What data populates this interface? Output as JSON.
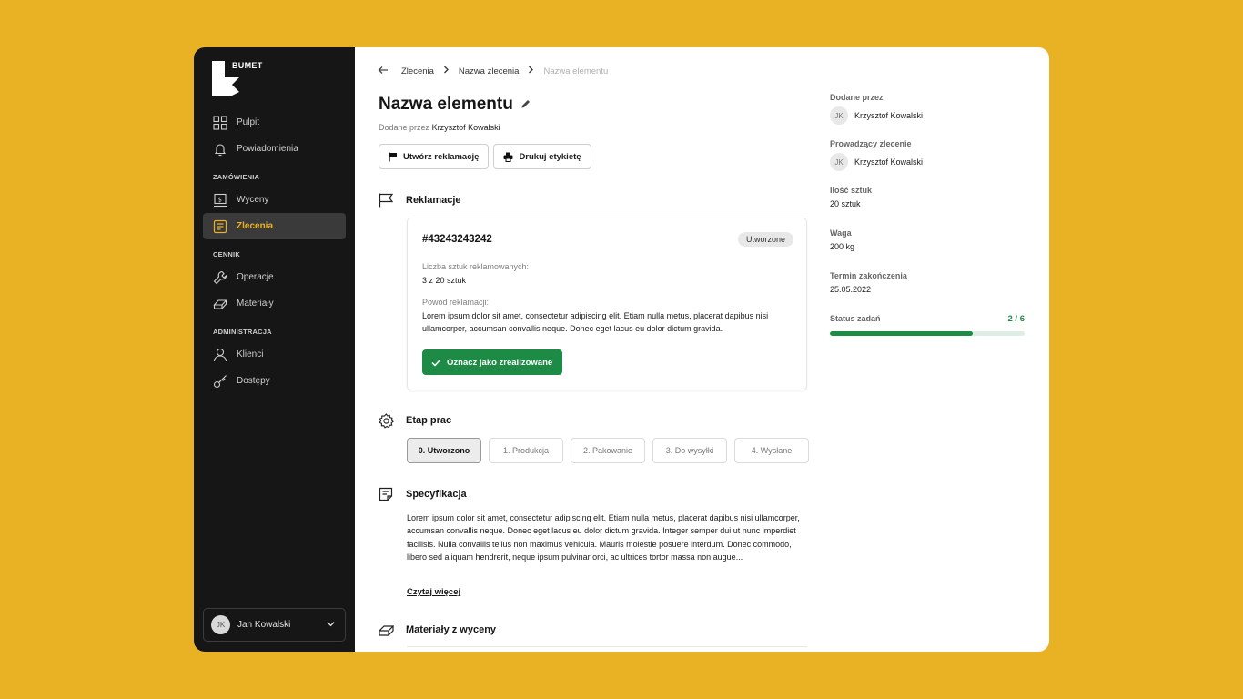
{
  "brand": {
    "name": "BUMET"
  },
  "sidebar": {
    "items_top": [
      {
        "label": "Pulpit",
        "icon": "grid-icon"
      },
      {
        "label": "Powiadomienia",
        "icon": "bell-icon"
      }
    ],
    "sections": [
      {
        "title": "ZAMÓWIENIA",
        "items": [
          {
            "label": "Wyceny",
            "icon": "quote-icon"
          },
          {
            "label": "Zlecenia",
            "icon": "orders-icon",
            "active": true
          }
        ]
      },
      {
        "title": "CENNIK",
        "items": [
          {
            "label": "Operacje",
            "icon": "wrench-icon"
          },
          {
            "label": "Materiały",
            "icon": "materials-icon"
          }
        ]
      },
      {
        "title": "ADMINISTRACJA",
        "items": [
          {
            "label": "Klienci",
            "icon": "user-icon"
          },
          {
            "label": "Dostępy",
            "icon": "key-icon"
          }
        ]
      }
    ],
    "user": {
      "initials": "JK",
      "name": "Jan Kowalski"
    }
  },
  "breadcrumb": {
    "items": [
      "Zlecenia",
      "Nazwa zlecenia",
      "Nazwa elementu"
    ]
  },
  "page": {
    "title": "Nazwa elementu",
    "added_by_prefix": "Dodane przez",
    "added_by_name": "Krzysztof Kowalski",
    "actions": {
      "complaint": "Utwórz reklamację",
      "print": "Drukuj etykietę"
    }
  },
  "complaints": {
    "title": "Reklamacje",
    "card": {
      "id": "#43243243242",
      "status": "Utworzone",
      "count_label": "Liczba sztuk reklamowanych:",
      "count_value": "3 z 20 sztuk",
      "reason_label": "Powód reklamacji:",
      "reason_value": "Lorem ipsum dolor sit amet, consectetur adipiscing elit. Etiam nulla metus, placerat dapibus nisi ullamcorper, accumsan convallis neque. Donec eget lacus eu dolor dictum gravida.",
      "resolve_label": "Oznacz jako zrealizowane"
    }
  },
  "stage": {
    "title": "Etap prac",
    "items": [
      "0. Utworzono",
      "1. Produkcja",
      "2. Pakowanie",
      "3. Do wysyłki",
      "4. Wysłane"
    ],
    "active_index": 0
  },
  "spec": {
    "title": "Specyfikacja",
    "text": "Lorem ipsum dolor sit amet, consectetur adipiscing elit. Etiam nulla metus, placerat dapibus nisi ullamcorper, accumsan convallis neque. Donec eget lacus eu dolor dictum gravida. Integer semper dui ut nunc imperdiet facilisis. Nulla convallis tellus non maximus vehicula. Mauris molestie posuere interdum. Donec commodo, libero sed aliquam hendrerit, neque ipsum pulvinar orci, ac ultrices tortor massa non augue...",
    "read_more": "Czytaj więcej"
  },
  "materials": {
    "title": "Materiały z wyceny"
  },
  "details": {
    "added_by_label": "Dodane przez",
    "added_by_initials": "JK",
    "added_by_name": "Krzysztof Kowalski",
    "lead_label": "Prowadzący zlecenie",
    "lead_initials": "JK",
    "lead_name": "Krzysztof Kowalski",
    "qty_label": "Ilość sztuk",
    "qty_value": "20 sztuk",
    "weight_label": "Waga",
    "weight_value": "200 kg",
    "deadline_label": "Termin zakończenia",
    "deadline_value": "25.05.2022",
    "status_label": "Status zadań",
    "status_count": "2 / 6",
    "status_progress": 0.733
  },
  "colors": {
    "accent": "#E9B124",
    "sidebar": "#161616",
    "success": "#1d8a45"
  }
}
